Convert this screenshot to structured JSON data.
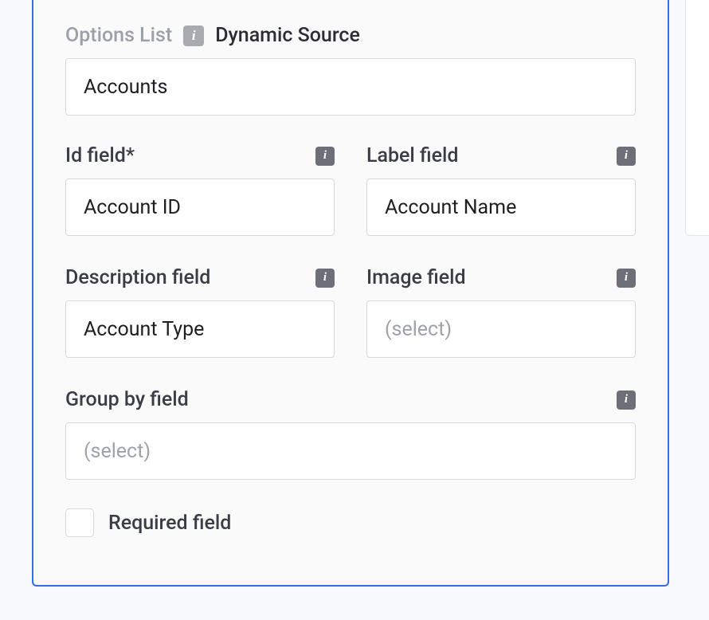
{
  "header": {
    "muted_label": "Options List",
    "active_label": "Dynamic Source"
  },
  "options_source": {
    "value": "Accounts"
  },
  "id_field": {
    "label": "Id field*",
    "value": "Account ID"
  },
  "label_field": {
    "label": "Label field",
    "value": "Account Name"
  },
  "description_field": {
    "label": "Description field",
    "value": "Account Type"
  },
  "image_field": {
    "label": "Image field",
    "placeholder": "(select)"
  },
  "group_by_field": {
    "label": "Group by field",
    "placeholder": "(select)"
  },
  "required": {
    "label": "Required field"
  }
}
